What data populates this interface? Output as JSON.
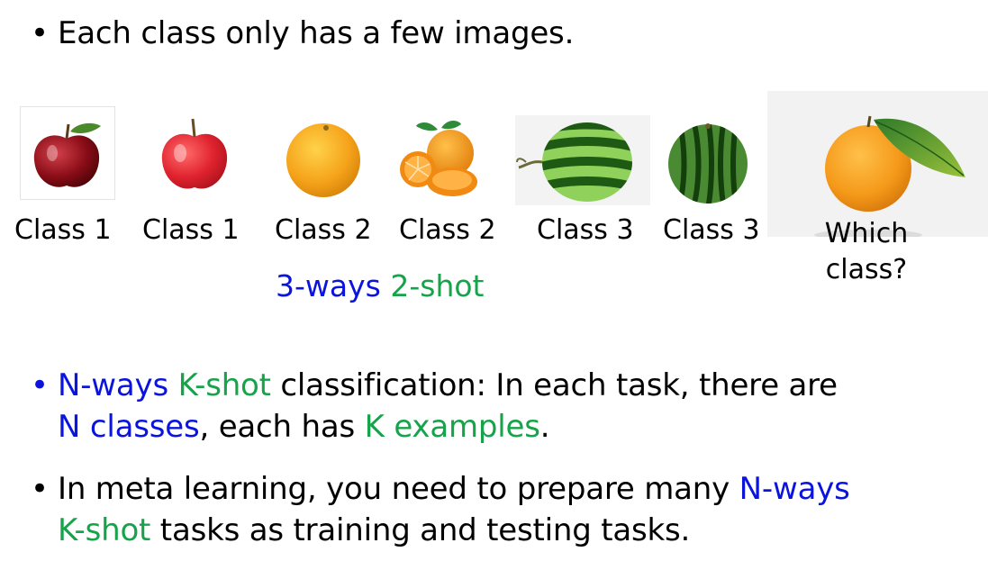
{
  "intro_bullet": "Each class only has a few images.",
  "images": [
    {
      "icon": "red-apple-icon",
      "caption": "Class 1"
    },
    {
      "icon": "red-apple-icon",
      "caption": "Class 1"
    },
    {
      "icon": "orange-icon",
      "caption": "Class 2"
    },
    {
      "icon": "sliced-orange-icon",
      "caption": "Class 2"
    },
    {
      "icon": "watermelon-icon",
      "caption": "Class 3"
    },
    {
      "icon": "watermelon-icon",
      "caption": "Class 3"
    }
  ],
  "query": {
    "icon": "tangerine-with-leaf-icon",
    "line1": "Which",
    "line2": "class?"
  },
  "task_label": {
    "ways": "3-ways",
    "shot": "2-shot"
  },
  "bullet2": {
    "ways": "N-ways",
    "shot": "K-shot",
    "text1": " classification: In each task, there are",
    "classes": "N classes",
    "text2": ", each has ",
    "examples": "K examples",
    "text3": "."
  },
  "bullet3": {
    "text1": "In meta learning, you need to prepare many ",
    "ways": "N-ways",
    "shot": "K-shot",
    "text2": " tasks as training and testing tasks."
  },
  "colors": {
    "ways_blue": "#0a14dc",
    "shot_green": "#16a34a"
  }
}
